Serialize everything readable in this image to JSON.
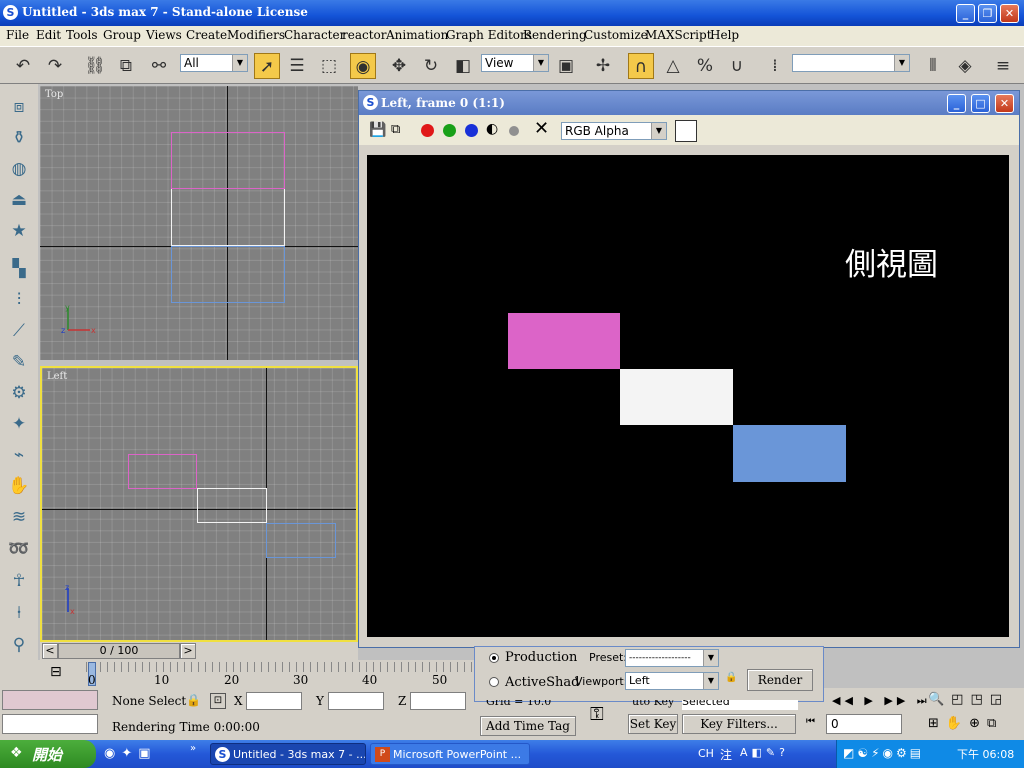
{
  "window": {
    "title": "Untitled - 3ds max 7  - Stand-alone License",
    "app_icon": "3ds-max-icon"
  },
  "menu": [
    "File",
    "Edit",
    "Tools",
    "Group",
    "Views",
    "Create",
    "Modifiers",
    "Character",
    "reactor",
    "Animation",
    "Graph Editors",
    "Rendering",
    "Customize",
    "MAXScript",
    "Help"
  ],
  "toolbar": {
    "selection_filter": "All",
    "reference_coord": "View",
    "named_selection": ""
  },
  "viewports": {
    "top_label": "Top",
    "left_label": "Left"
  },
  "render_window": {
    "title": "Left, frame 0 (1:1)",
    "channel": "RGB Alpha",
    "caption": "側視圖"
  },
  "timeline": {
    "frame_counter": "0 / 100",
    "prev": "<",
    "next": ">",
    "ticks": [
      "0",
      "10",
      "20",
      "30",
      "40",
      "50"
    ]
  },
  "status": {
    "selection": "None Select",
    "x_label": "X",
    "y_label": "Y",
    "z_label": "Z",
    "render_time": "Rendering Time  0:00:00",
    "add_time_tag": "Add Time Tag"
  },
  "render_dialog": {
    "production": "Production",
    "activeshade": "ActiveShad",
    "preset_label": "Preset:",
    "preset_value": "-------------------",
    "viewport_label": "Viewport:",
    "viewport_value": "Left",
    "render_button": "Render",
    "grid_text": "Grid = 10.0",
    "auto_key_text": "uto Key",
    "selected_value": "Selected"
  },
  "anim": {
    "set_key": "Set Key",
    "key_filters": "Key Filters...",
    "frame_value": "0"
  },
  "taskbar": {
    "start": "開始",
    "tasks": [
      {
        "label": "Untitled - 3ds max 7 - ..."
      },
      {
        "label": "Microsoft PowerPoint ..."
      }
    ],
    "tray_lang": "CH",
    "tray_ime": "注",
    "time": "下午 06:08"
  },
  "colors": {
    "pink": "#dc64c8",
    "white": "#f4f4f4",
    "blue": "#6a96d8",
    "viewport_bg": "#808080"
  }
}
